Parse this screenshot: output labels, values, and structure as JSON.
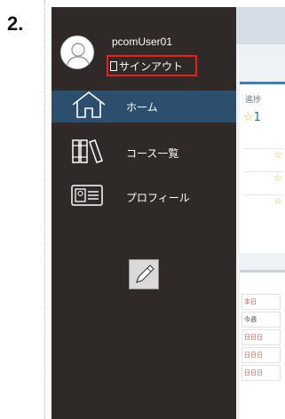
{
  "step": {
    "number": "2."
  },
  "drawer": {
    "user": {
      "name": "pcomUser01",
      "signout_label": "サインアウト"
    },
    "menu": [
      {
        "label": "ホーム",
        "icon": "home-icon",
        "active": true
      },
      {
        "label": "コース一覧",
        "icon": "books-icon",
        "active": false
      },
      {
        "label": "プロフィール",
        "icon": "id-card-icon",
        "active": false
      }
    ],
    "edit_icon": "pencil-icon"
  },
  "background_app": {
    "card": {
      "header": "進捗",
      "value": "1"
    },
    "list": [
      "本日",
      "今週",
      "日日日",
      "日日日",
      "日日日"
    ]
  },
  "colors": {
    "drawer_bg": "#2f2a28",
    "active_item": "#2b4f6c",
    "highlight": "#e8201d",
    "accent": "#3a7fb8"
  }
}
